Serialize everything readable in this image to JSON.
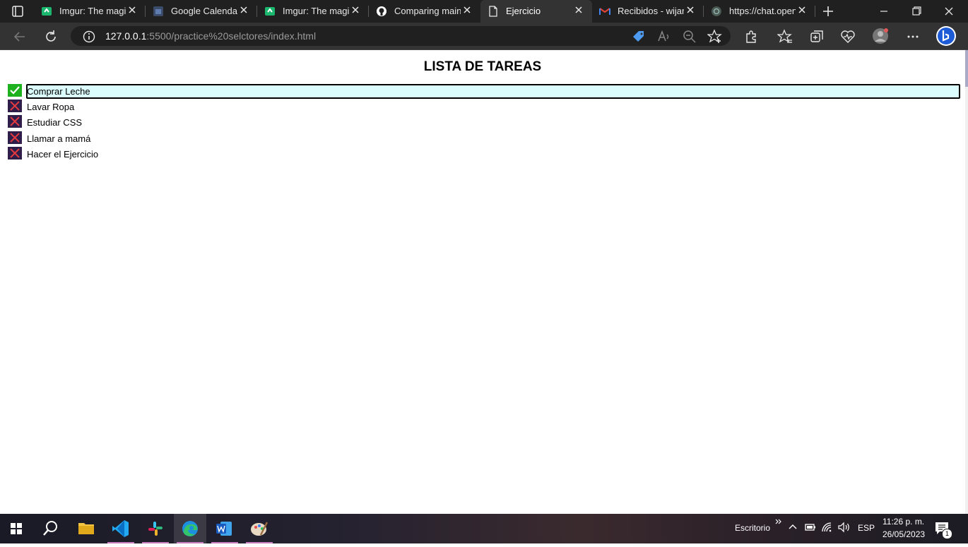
{
  "browser": {
    "tabs": [
      {
        "label": "Imgur: The magic of the Internet",
        "icon": "imgur-icon",
        "active": false
      },
      {
        "label": "Google Calendar",
        "icon": "calendar-icon",
        "active": false
      },
      {
        "label": "Imgur: The magic of the Internet",
        "icon": "imgur-icon",
        "active": false
      },
      {
        "label": "Comparing main...",
        "icon": "github-icon",
        "active": false
      },
      {
        "label": "Ejercicio",
        "icon": "page-icon",
        "active": true
      },
      {
        "label": "Recibidos - wijard",
        "icon": "gmail-icon",
        "active": false
      },
      {
        "label": "https://chat.openai.com",
        "icon": "openai-icon",
        "active": false
      }
    ],
    "url_host": "127.0.0.1",
    "url_path": ":5500/practice%20selctores/index.html",
    "colors": {
      "chrome_dark": "#202020",
      "chrome_bar": "#333333"
    }
  },
  "page": {
    "title": "LISTA DE TAREAS",
    "tasks": [
      {
        "label": "Comprar Leche",
        "status": "done",
        "icon": "check-icon"
      },
      {
        "label": "Lavar Ropa",
        "status": "pending",
        "icon": "x-icon"
      },
      {
        "label": "Estudiar CSS",
        "status": "pending",
        "icon": "x-icon"
      },
      {
        "label": "Llamar a mamá",
        "status": "pending",
        "icon": "x-icon"
      },
      {
        "label": "Hacer el Ejercicio",
        "status": "pending",
        "icon": "x-icon"
      }
    ],
    "colors": {
      "done": "#1db21d",
      "pending_bg": "#2f1e4a",
      "pending_x": "#e0393e",
      "highlight": "#dcfdfd"
    }
  },
  "taskbar": {
    "apps": [
      "start-icon",
      "search-icon",
      "file-explorer-icon",
      "vscode-icon",
      "slack-icon",
      "edge-icon",
      "word-icon",
      "paint-icon"
    ],
    "desktop_label": "Escritorio",
    "language": "ESP",
    "time": "11:26 p. m.",
    "date": "26/05/2023",
    "notification_count": "1"
  }
}
